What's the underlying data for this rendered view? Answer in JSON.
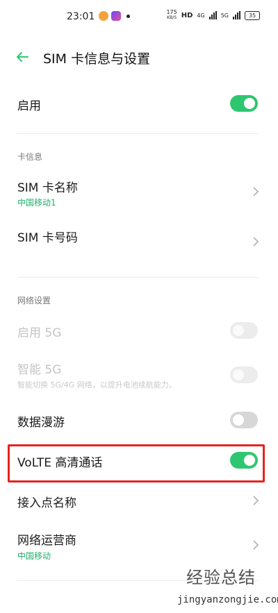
{
  "status_bar": {
    "time": "23:01",
    "net_speed_value": "175",
    "net_speed_unit": "KB/S",
    "hd": "HD",
    "network_4g": "4G",
    "network_5g": "5G",
    "battery": "35"
  },
  "header": {
    "title": "SIM 卡信息与设置"
  },
  "enable": {
    "label": "启用",
    "on": true
  },
  "card_info": {
    "section_title": "卡信息",
    "sim_name_label": "SIM 卡名称",
    "sim_name_value": "中国移动1",
    "sim_number_label": "SIM 卡号码"
  },
  "network": {
    "section_title": "网络设置",
    "enable_5g_label": "启用 5G",
    "smart_5g_label": "智能 5G",
    "smart_5g_desc": "智能切换 5G/4G 网络，以提升电池续航能力。",
    "roaming_label": "数据漫游",
    "volte_label": "VoLTE 高清通话",
    "apn_label": "接入点名称",
    "operator_label": "网络运营商",
    "operator_value": "中国移动"
  },
  "watermark": {
    "logo": "经验总结",
    "url": "jingyanzongjie.com"
  },
  "colors": {
    "accent": "#2ec770",
    "highlight": "#e8231d"
  }
}
